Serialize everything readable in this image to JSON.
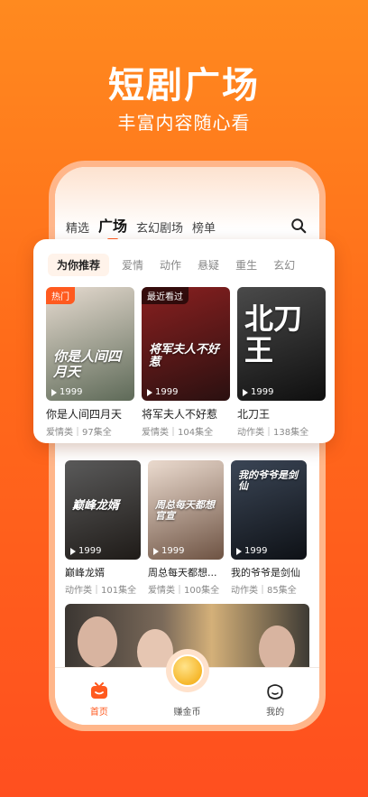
{
  "hero": {
    "title": "短剧广场",
    "subtitle": "丰富内容随心看"
  },
  "top_tabs": [
    "精选",
    "广场",
    "玄幻剧场",
    "榜单"
  ],
  "categories": [
    "为你推荐",
    "爱情",
    "动作",
    "悬疑",
    "重生",
    "玄幻"
  ],
  "featured": [
    {
      "badge": "热门",
      "poster_text": "你是人间四月天",
      "plays": "1999",
      "title": "你是人间四月天",
      "meta": "爱情类｜97集全",
      "color_a": "#d7c9bd",
      "color_b": "#5e6a58"
    },
    {
      "badge": "最近看过",
      "poster_text": "将军夫人不好惹",
      "plays": "1999",
      "title": "将军夫人不好惹",
      "meta": "爱情类｜104集全",
      "color_a": "#7a1a1a",
      "color_b": "#2a1010"
    },
    {
      "badge": "",
      "poster_text": "北刀王",
      "plays": "1999",
      "title": "北刀王",
      "meta": "动作类｜138集全",
      "color_a": "#3c3c3c",
      "color_b": "#0f0f0f"
    }
  ],
  "second_row": [
    {
      "poster_text": "巅峰龙婿",
      "plays": "1999",
      "title": "巅峰龙婿",
      "meta": "动作类｜101集全",
      "color_a": "#4a4a4a",
      "color_b": "#1f1b18"
    },
    {
      "poster_text": "周总每天都想官宣",
      "plays": "1999",
      "title": "周总每天都想...",
      "meta": "爱情类｜100集全",
      "color_a": "#e7d3c6",
      "color_b": "#7a5a48"
    },
    {
      "poster_text": "我的爷爷是剑仙",
      "plays": "1999",
      "title": "我的爷爷是剑仙",
      "meta": "动作类｜85集全",
      "color_a": "#2b3440",
      "color_b": "#0e1116"
    }
  ],
  "nav": {
    "home": "首页",
    "earn": "赚金币",
    "me": "我的"
  },
  "colors": {
    "accent": "#ff5a1f",
    "bg_top": "#ff8a1f",
    "bg_bottom": "#ff4f1f"
  }
}
